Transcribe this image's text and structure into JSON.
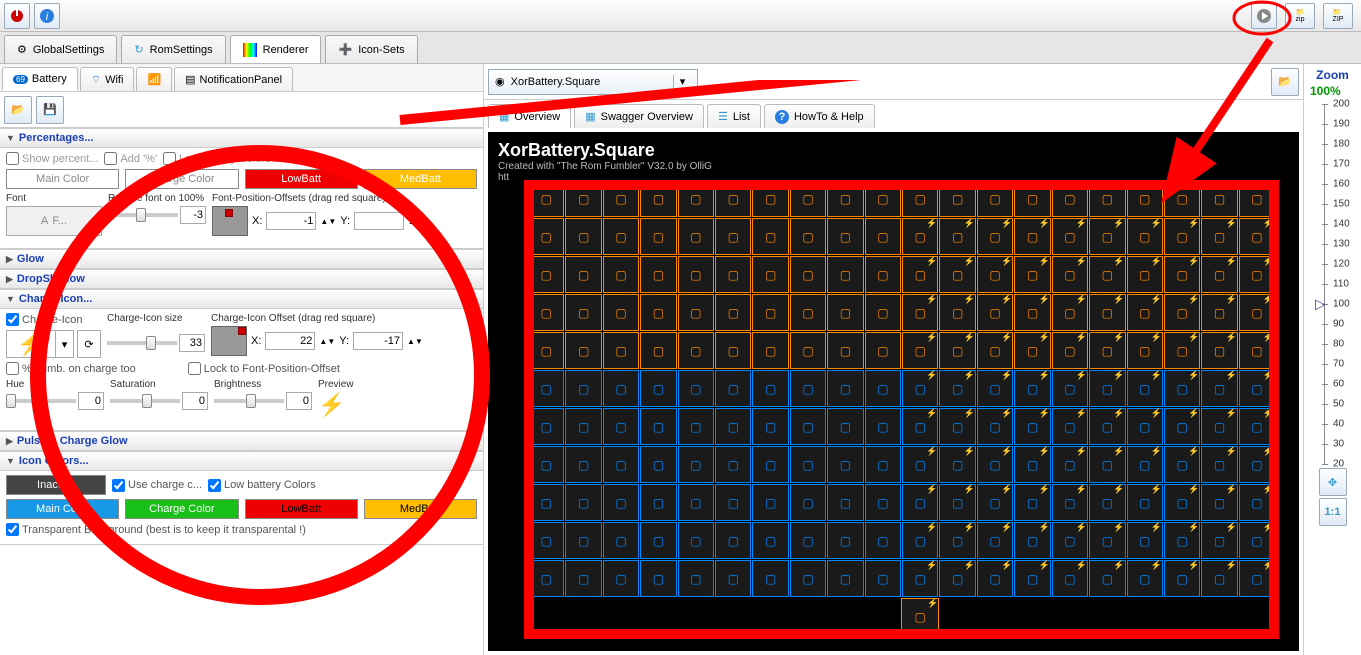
{
  "toolbar": {
    "power": "power-icon",
    "info": "info-icon",
    "play": "play-icon",
    "zip1": "zip",
    "zip2": "zip"
  },
  "main_tabs": [
    {
      "icon": "gear",
      "label": "GlobalSettings"
    },
    {
      "icon": "refresh",
      "label": "RomSettings"
    },
    {
      "icon": "palette",
      "label": "Renderer"
    },
    {
      "icon": "plus",
      "label": "Icon-Sets"
    }
  ],
  "sub_tabs": [
    {
      "icon": "batt",
      "label": "Battery",
      "active": true
    },
    {
      "icon": "wifi",
      "label": "Wifi"
    },
    {
      "icon": "signal",
      "label": ""
    },
    {
      "icon": "notif",
      "label": "NotificationPanel"
    }
  ],
  "percentages": {
    "header": "Percentages...",
    "show_percent": "Show percent...",
    "add_pct": "Add '%'",
    "low_batt_colors": "Low battery Colors",
    "btn_main": "Main Color",
    "btn_charge": "Charge Color",
    "btn_low": "LowBatt",
    "btn_med": "MedBatt",
    "font_lbl": "Font",
    "font_val": "F...",
    "reduce_lbl": "Reduce font on 100%",
    "reduce_val": "-3",
    "offset_lbl": "Font-Position-Offsets (drag red square)",
    "x_lbl": "X:",
    "x_val": "-1",
    "y_lbl": "Y:",
    "y_val": ""
  },
  "glow": {
    "header": "Glow"
  },
  "dropshadow": {
    "header": "DropShadow"
  },
  "chargeicon": {
    "header": "Charge-Icon...",
    "chk": "Charge-Icon",
    "size_lbl": "Charge-Icon size",
    "size_val": "33",
    "off_lbl": "Charge-Icon Offset (drag red square)",
    "x": "X:",
    "x_val": "22",
    "y": "Y:",
    "y_val": "-17",
    "numb": "% numb. on charge too",
    "lock": "Lock to Font-Position-Offset",
    "hue": "Hue",
    "sat": "Saturation",
    "bri": "Brightness",
    "prev": "Preview",
    "hue_val": "0",
    "sat_val": "0",
    "bri_val": "0"
  },
  "pulsing": {
    "header": "Pulsing Charge Glow"
  },
  "iconcolors": {
    "header": "Icon Colors...",
    "inactive": "Inactive",
    "use_charge": "Use charge c...",
    "low_batt": "Low battery Colors",
    "main": "Main Color",
    "charge": "Charge Color",
    "low": "LowBatt",
    "med": "MedBatt",
    "transp": "Transparent Background (best is to keep it transparental !)"
  },
  "combo": {
    "label": "XorBattery.Square"
  },
  "right_tabs": [
    {
      "icon": "grid",
      "label": "Overview",
      "active": true
    },
    {
      "icon": "grid2",
      "label": "Swagger Overview"
    },
    {
      "icon": "list",
      "label": "List"
    },
    {
      "icon": "help",
      "label": "HowTo & Help"
    }
  ],
  "preview": {
    "title": "XorBattery.Square",
    "sub": "Created with \"The Rom Fumbler\" V32.0 by OlliG",
    "sub2": "htt"
  },
  "zoom": {
    "title": "Zoom",
    "pct": "100%",
    "ticks": [
      200,
      190,
      180,
      170,
      160,
      150,
      140,
      130,
      120,
      110,
      100,
      90,
      80,
      70,
      60,
      50,
      40,
      30,
      20
    ],
    "pointer_at": 100,
    "btn_fit": "fit",
    "btn_11": "1:1"
  }
}
